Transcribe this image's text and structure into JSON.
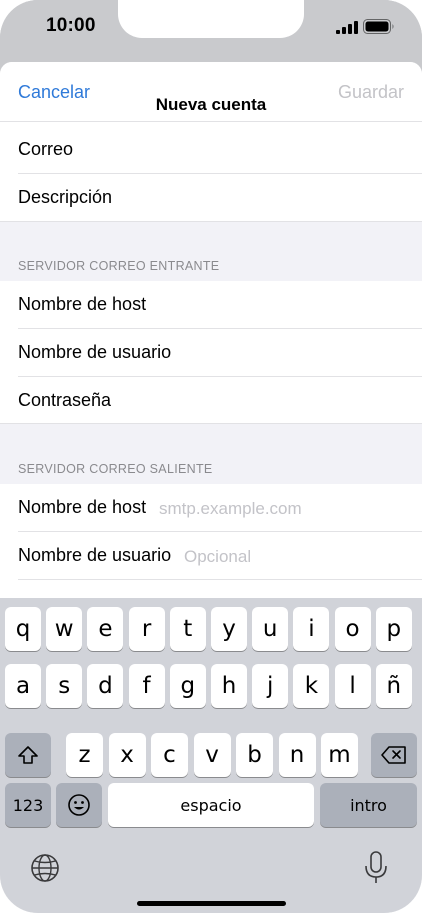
{
  "status": {
    "time": "10:00"
  },
  "nav": {
    "cancel": "Cancelar",
    "title": "Nueva cuenta",
    "save": "Guardar"
  },
  "account_rows": [
    {
      "label": "Correo"
    },
    {
      "label": "Descripción"
    }
  ],
  "incoming": {
    "header": "SERVIDOR CORREO ENTRANTE",
    "rows": [
      {
        "label": "Nombre de host"
      },
      {
        "label": "Nombre de usuario"
      },
      {
        "label": "Contraseña"
      }
    ]
  },
  "outgoing": {
    "header": "SERVIDOR CORREO SALIENTE",
    "rows": [
      {
        "label": "Nombre de host",
        "placeholder": "smtp.example.com"
      },
      {
        "label": "Nombre de usuario",
        "placeholder": "Opcional"
      }
    ]
  },
  "keyboard": {
    "row1": [
      "q",
      "w",
      "e",
      "r",
      "t",
      "y",
      "u",
      "i",
      "o",
      "p"
    ],
    "row2": [
      "a",
      "s",
      "d",
      "f",
      "g",
      "h",
      "j",
      "k",
      "l",
      "ñ"
    ],
    "row3": [
      "z",
      "x",
      "c",
      "v",
      "b",
      "n",
      "m"
    ],
    "numbers": "123",
    "space": "espacio",
    "return": "intro",
    "shift_icon": "shift-icon",
    "delete_icon": "delete-icon",
    "emoji_icon": "emoji-icon",
    "globe_icon": "globe-icon",
    "mic_icon": "microphone-icon"
  },
  "colors": {
    "accent": "#2f7ad9",
    "disabled": "#c3c3c7",
    "grouped_bg": "#f2f2f7",
    "keyboard_bg": "#d1d3d9"
  }
}
